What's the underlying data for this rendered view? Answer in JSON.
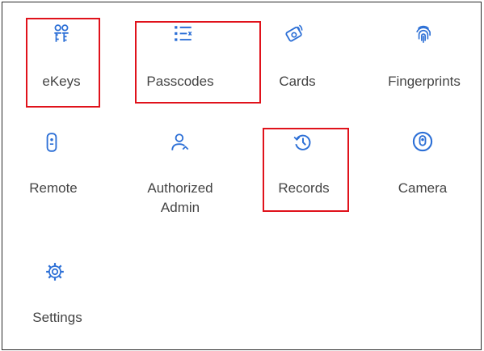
{
  "menu": {
    "items": [
      {
        "id": "ekeys",
        "label": "eKeys",
        "icon": "key-people-icon",
        "highlighted": true
      },
      {
        "id": "passcodes",
        "label": "Passcodes",
        "icon": "list-icon",
        "highlighted": true
      },
      {
        "id": "cards",
        "label": "Cards",
        "icon": "card-icon",
        "highlighted": false
      },
      {
        "id": "fingerprints",
        "label": "Fingerprints",
        "icon": "fingerprint-icon",
        "highlighted": false
      },
      {
        "id": "remote",
        "label": "Remote",
        "icon": "remote-icon",
        "highlighted": false
      },
      {
        "id": "authorized-admin",
        "label": "Authorized Admin",
        "line1": "Authorized",
        "line2": "Admin",
        "icon": "admin-user-icon",
        "highlighted": false
      },
      {
        "id": "records",
        "label": "Records",
        "icon": "history-icon",
        "highlighted": true
      },
      {
        "id": "camera",
        "label": "Camera",
        "icon": "camera-icon",
        "highlighted": false
      },
      {
        "id": "settings",
        "label": "Settings",
        "icon": "gear-icon",
        "highlighted": false
      }
    ]
  },
  "colors": {
    "accent": "#2c6fd6",
    "text": "#444444",
    "highlight": "#e0121b",
    "border": "#2a2a2a"
  }
}
